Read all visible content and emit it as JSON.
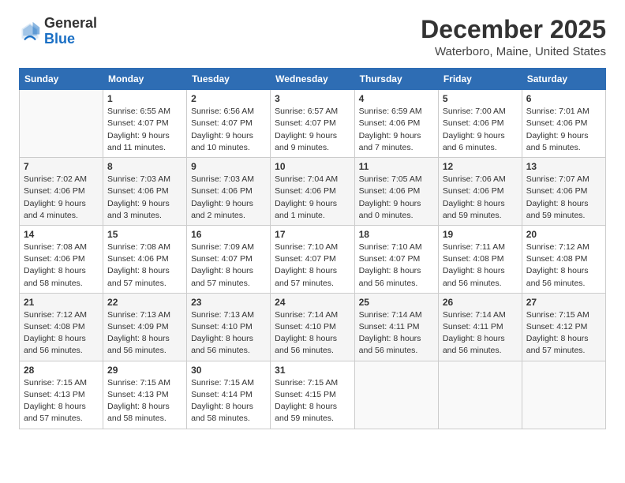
{
  "header": {
    "logo_general": "General",
    "logo_blue": "Blue",
    "month_title": "December 2025",
    "location": "Waterboro, Maine, United States"
  },
  "days_of_week": [
    "Sunday",
    "Monday",
    "Tuesday",
    "Wednesday",
    "Thursday",
    "Friday",
    "Saturday"
  ],
  "weeks": [
    [
      {
        "day": "",
        "info": ""
      },
      {
        "day": "1",
        "info": "Sunrise: 6:55 AM\nSunset: 4:07 PM\nDaylight: 9 hours\nand 11 minutes."
      },
      {
        "day": "2",
        "info": "Sunrise: 6:56 AM\nSunset: 4:07 PM\nDaylight: 9 hours\nand 10 minutes."
      },
      {
        "day": "3",
        "info": "Sunrise: 6:57 AM\nSunset: 4:07 PM\nDaylight: 9 hours\nand 9 minutes."
      },
      {
        "day": "4",
        "info": "Sunrise: 6:59 AM\nSunset: 4:06 PM\nDaylight: 9 hours\nand 7 minutes."
      },
      {
        "day": "5",
        "info": "Sunrise: 7:00 AM\nSunset: 4:06 PM\nDaylight: 9 hours\nand 6 minutes."
      },
      {
        "day": "6",
        "info": "Sunrise: 7:01 AM\nSunset: 4:06 PM\nDaylight: 9 hours\nand 5 minutes."
      }
    ],
    [
      {
        "day": "7",
        "info": "Sunrise: 7:02 AM\nSunset: 4:06 PM\nDaylight: 9 hours\nand 4 minutes."
      },
      {
        "day": "8",
        "info": "Sunrise: 7:03 AM\nSunset: 4:06 PM\nDaylight: 9 hours\nand 3 minutes."
      },
      {
        "day": "9",
        "info": "Sunrise: 7:03 AM\nSunset: 4:06 PM\nDaylight: 9 hours\nand 2 minutes."
      },
      {
        "day": "10",
        "info": "Sunrise: 7:04 AM\nSunset: 4:06 PM\nDaylight: 9 hours\nand 1 minute."
      },
      {
        "day": "11",
        "info": "Sunrise: 7:05 AM\nSunset: 4:06 PM\nDaylight: 9 hours\nand 0 minutes."
      },
      {
        "day": "12",
        "info": "Sunrise: 7:06 AM\nSunset: 4:06 PM\nDaylight: 8 hours\nand 59 minutes."
      },
      {
        "day": "13",
        "info": "Sunrise: 7:07 AM\nSunset: 4:06 PM\nDaylight: 8 hours\nand 59 minutes."
      }
    ],
    [
      {
        "day": "14",
        "info": "Sunrise: 7:08 AM\nSunset: 4:06 PM\nDaylight: 8 hours\nand 58 minutes."
      },
      {
        "day": "15",
        "info": "Sunrise: 7:08 AM\nSunset: 4:06 PM\nDaylight: 8 hours\nand 57 minutes."
      },
      {
        "day": "16",
        "info": "Sunrise: 7:09 AM\nSunset: 4:07 PM\nDaylight: 8 hours\nand 57 minutes."
      },
      {
        "day": "17",
        "info": "Sunrise: 7:10 AM\nSunset: 4:07 PM\nDaylight: 8 hours\nand 57 minutes."
      },
      {
        "day": "18",
        "info": "Sunrise: 7:10 AM\nSunset: 4:07 PM\nDaylight: 8 hours\nand 56 minutes."
      },
      {
        "day": "19",
        "info": "Sunrise: 7:11 AM\nSunset: 4:08 PM\nDaylight: 8 hours\nand 56 minutes."
      },
      {
        "day": "20",
        "info": "Sunrise: 7:12 AM\nSunset: 4:08 PM\nDaylight: 8 hours\nand 56 minutes."
      }
    ],
    [
      {
        "day": "21",
        "info": "Sunrise: 7:12 AM\nSunset: 4:08 PM\nDaylight: 8 hours\nand 56 minutes."
      },
      {
        "day": "22",
        "info": "Sunrise: 7:13 AM\nSunset: 4:09 PM\nDaylight: 8 hours\nand 56 minutes."
      },
      {
        "day": "23",
        "info": "Sunrise: 7:13 AM\nSunset: 4:10 PM\nDaylight: 8 hours\nand 56 minutes."
      },
      {
        "day": "24",
        "info": "Sunrise: 7:14 AM\nSunset: 4:10 PM\nDaylight: 8 hours\nand 56 minutes."
      },
      {
        "day": "25",
        "info": "Sunrise: 7:14 AM\nSunset: 4:11 PM\nDaylight: 8 hours\nand 56 minutes."
      },
      {
        "day": "26",
        "info": "Sunrise: 7:14 AM\nSunset: 4:11 PM\nDaylight: 8 hours\nand 56 minutes."
      },
      {
        "day": "27",
        "info": "Sunrise: 7:15 AM\nSunset: 4:12 PM\nDaylight: 8 hours\nand 57 minutes."
      }
    ],
    [
      {
        "day": "28",
        "info": "Sunrise: 7:15 AM\nSunset: 4:13 PM\nDaylight: 8 hours\nand 57 minutes."
      },
      {
        "day": "29",
        "info": "Sunrise: 7:15 AM\nSunset: 4:13 PM\nDaylight: 8 hours\nand 58 minutes."
      },
      {
        "day": "30",
        "info": "Sunrise: 7:15 AM\nSunset: 4:14 PM\nDaylight: 8 hours\nand 58 minutes."
      },
      {
        "day": "31",
        "info": "Sunrise: 7:15 AM\nSunset: 4:15 PM\nDaylight: 8 hours\nand 59 minutes."
      },
      {
        "day": "",
        "info": ""
      },
      {
        "day": "",
        "info": ""
      },
      {
        "day": "",
        "info": ""
      }
    ]
  ]
}
